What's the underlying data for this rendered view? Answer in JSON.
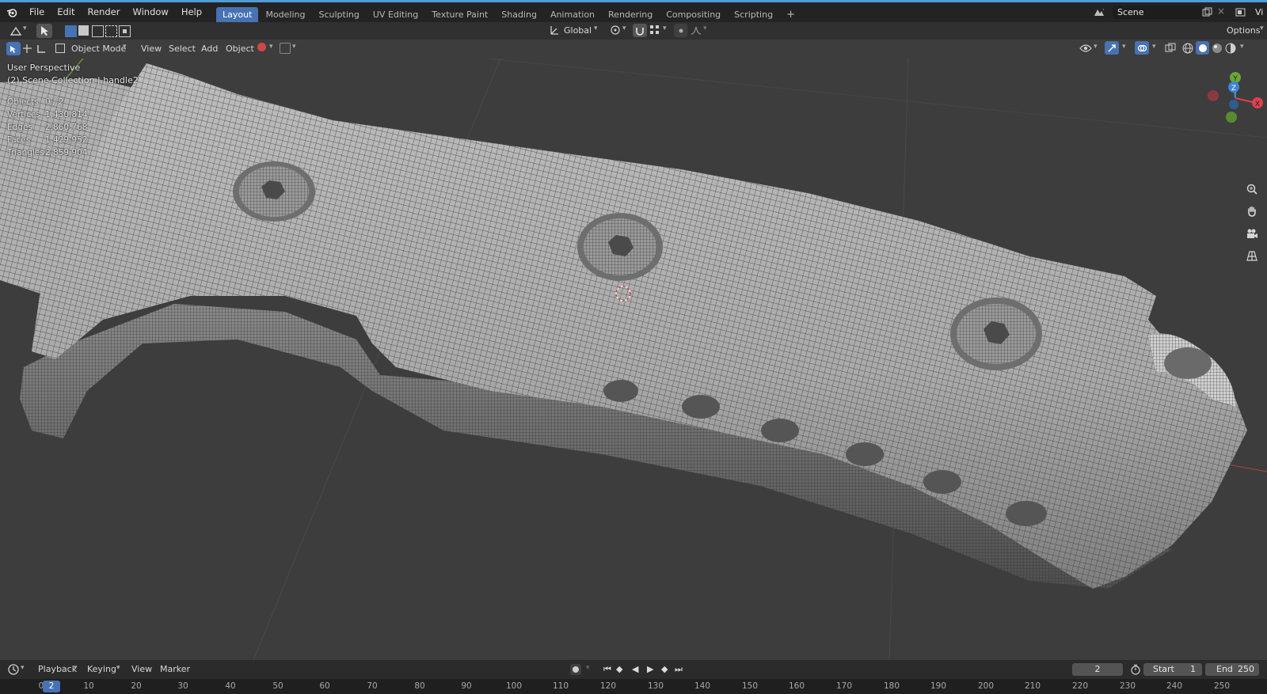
{
  "menubar": {
    "file": "File",
    "edit": "Edit",
    "render": "Render",
    "window": "Window",
    "help": "Help",
    "workspaces": [
      "Layout",
      "Modeling",
      "Sculpting",
      "UV Editing",
      "Texture Paint",
      "Shading",
      "Animation",
      "Rendering",
      "Compositing",
      "Scripting"
    ],
    "active_workspace": "Layout",
    "add_tab": "+",
    "scene_label": "Scene",
    "view_layer_label": "Vi"
  },
  "toolheader": {
    "orientation": "Global",
    "options": "Options"
  },
  "viewport_header": {
    "mode": "Object Mode",
    "view": "View",
    "select": "Select",
    "add": "Add",
    "object": "Object"
  },
  "overlay": {
    "perspective": "User Perspective",
    "collection": "(2) Scene Collection | handle2",
    "stats": [
      {
        "label": "Objects",
        "value": "0 / 2"
      },
      {
        "label": "Vertices",
        "value": "1,430,814"
      },
      {
        "label": "Edges",
        "value": "2,860,768"
      },
      {
        "label": "Faces",
        "value": "1,429,952"
      },
      {
        "label": "Triangles",
        "value": "2,859,904"
      }
    ]
  },
  "gizmo": {
    "x": "X",
    "y": "Y",
    "z": "Z"
  },
  "timeline": {
    "playback": "Playback",
    "keying": "Keying",
    "view": "View",
    "marker": "Marker",
    "current_frame": "2",
    "start_label": "Start",
    "start_value": "1",
    "end_label": "End",
    "end_value": "250",
    "ruler_ticks": [
      "0",
      "10",
      "20",
      "30",
      "40",
      "50",
      "60",
      "70",
      "80",
      "90",
      "100",
      "110",
      "120",
      "130",
      "140",
      "150",
      "160",
      "170",
      "180",
      "190",
      "200",
      "210",
      "220",
      "230",
      "240",
      "250"
    ],
    "ruler_current": "2"
  },
  "colors": {
    "accent": "#4772b3",
    "background": "#3d3d3d",
    "x_axis": "#e0404a",
    "y_axis": "#6aa638",
    "z_axis": "#3d84d6"
  }
}
